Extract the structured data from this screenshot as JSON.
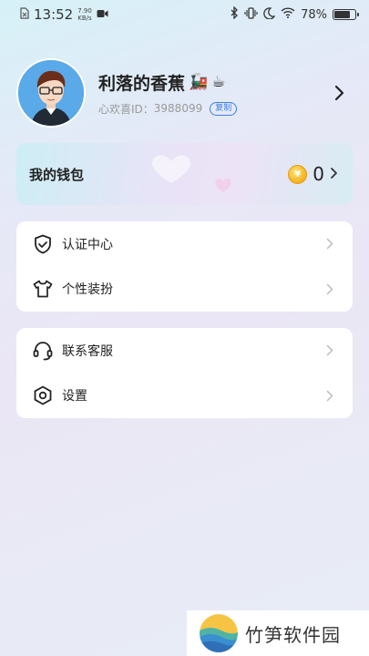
{
  "status_bar": {
    "time": "13:52",
    "net_speed_value": "7.90",
    "net_speed_unit": "KB/s",
    "battery": "78%",
    "battery_level": 0.78
  },
  "profile": {
    "username": "利落的香蕉",
    "emoji_1": "🚂",
    "emoji_2": "☕",
    "id_label": "心欢喜ID：",
    "id_value": "3988099",
    "copy_label": "复制"
  },
  "wallet": {
    "label": "我的钱包",
    "coin_glyph": "¥",
    "amount": "0"
  },
  "menu_group_1": [
    {
      "label": "认证中心",
      "icon": "shield-check-icon"
    },
    {
      "label": "个性装扮",
      "icon": "tshirt-icon"
    }
  ],
  "menu_group_2": [
    {
      "label": "联系客服",
      "icon": "headset-icon"
    },
    {
      "label": "设置",
      "icon": "settings-hexagon-icon"
    }
  ],
  "watermark": {
    "text": "竹笋软件园"
  },
  "colors": {
    "accent_blue": "#3b7fe0",
    "coin_gold": "#f5b21c"
  }
}
